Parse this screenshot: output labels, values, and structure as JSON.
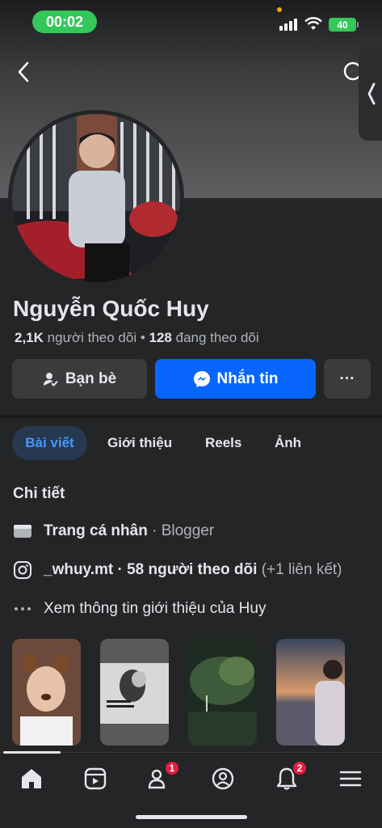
{
  "status": {
    "time": "00:02",
    "battery": "40"
  },
  "profile": {
    "name": "Nguyễn Quốc Huy",
    "followers_count": "2,1K",
    "followers_label": "người theo dõi",
    "separator": "•",
    "following_count": "128",
    "following_label": "đang theo dõi"
  },
  "actions": {
    "friends": "Bạn bè",
    "message": "Nhắn tin",
    "more": "···"
  },
  "tabs": [
    {
      "label": "Bài viết",
      "active": true
    },
    {
      "label": "Giới thiệu"
    },
    {
      "label": "Reels"
    },
    {
      "label": "Ảnh"
    }
  ],
  "details": {
    "title": "Chi tiết",
    "page_type": "Trang cá nhân",
    "page_category": " · Blogger",
    "instagram_handle": "_whuy.mt",
    "instagram_followers": " · 58 người theo dõi",
    "instagram_extra": " (+1 liên kết)",
    "see_more": "Xem thông tin giới thiệu của Huy"
  },
  "bottom_nav": {
    "items": [
      {
        "icon": "home-icon",
        "active": true
      },
      {
        "icon": "video-icon"
      },
      {
        "icon": "friends-icon",
        "badge": "1"
      },
      {
        "icon": "profile-icon"
      },
      {
        "icon": "bell-icon",
        "badge": "2"
      },
      {
        "icon": "menu-icon"
      }
    ]
  },
  "colors": {
    "accent": "#0866ff",
    "background": "#242526",
    "badge": "#e41e3f",
    "status_green": "#34c759"
  }
}
